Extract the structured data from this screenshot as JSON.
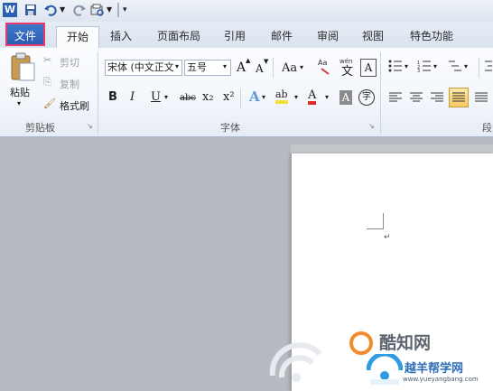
{
  "qat": {
    "icons": [
      "word-app-icon",
      "save-icon",
      "undo-icon",
      "redo-icon",
      "print-preview-icon",
      "customize-icon"
    ]
  },
  "tabs": [
    {
      "id": "file",
      "label": "文件"
    },
    {
      "id": "home",
      "label": "开始"
    },
    {
      "id": "insert",
      "label": "插入"
    },
    {
      "id": "page_layout",
      "label": "页面布局"
    },
    {
      "id": "references",
      "label": "引用"
    },
    {
      "id": "mailings",
      "label": "邮件"
    },
    {
      "id": "review",
      "label": "审阅"
    },
    {
      "id": "view",
      "label": "视图"
    },
    {
      "id": "special",
      "label": "特色功能"
    }
  ],
  "clipboard": {
    "paste": "粘贴",
    "cut": "剪切",
    "copy": "复制",
    "format_painter": "格式刷",
    "group_label": "剪贴板"
  },
  "font": {
    "font_name": "宋体 (中文正文",
    "font_size": "五号",
    "grow": "A",
    "shrink": "A",
    "change_case": "Aa",
    "phonetic": "wén",
    "bold": "B",
    "italic": "I",
    "underline": "U",
    "strike": "abc",
    "subscript": "x₂",
    "superscript": "x²",
    "highlight": "ab",
    "font_color": "A",
    "char_shading": "A",
    "enclose": "字",
    "group_label": "字体"
  },
  "paragraph": {
    "group_label": "段"
  },
  "watermark": {
    "brand1": "酷知网",
    "brand2": "越羊帮学网",
    "url": "www.yueyangbang.com"
  }
}
